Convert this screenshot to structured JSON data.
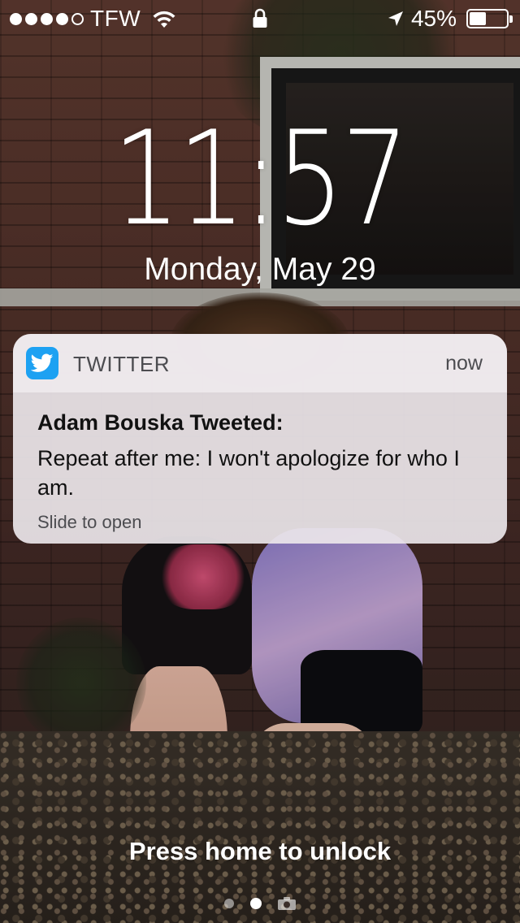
{
  "status_bar": {
    "signal_bars_filled": 4,
    "signal_bars_total": 5,
    "carrier": "TFW",
    "battery_percent": "45%",
    "battery_level": 0.45,
    "icons": [
      "wifi-icon",
      "lock-icon",
      "location-arrow-icon",
      "battery-icon"
    ]
  },
  "lock_screen": {
    "time": "11:57",
    "date": "Monday, May 29",
    "unlock_hint": "Press home to unlock",
    "page_indicator": {
      "count": 2,
      "active_index": 1,
      "trailing_icon": "camera-icon"
    }
  },
  "notification": {
    "app_icon": "twitter-bird-icon",
    "app_color": "#1DA1F2",
    "app_name": "TWITTER",
    "time": "now",
    "title": "Adam Bouska Tweeted:",
    "message": "Repeat after me: I won't apologize for who I am.",
    "action": "Slide to open"
  }
}
